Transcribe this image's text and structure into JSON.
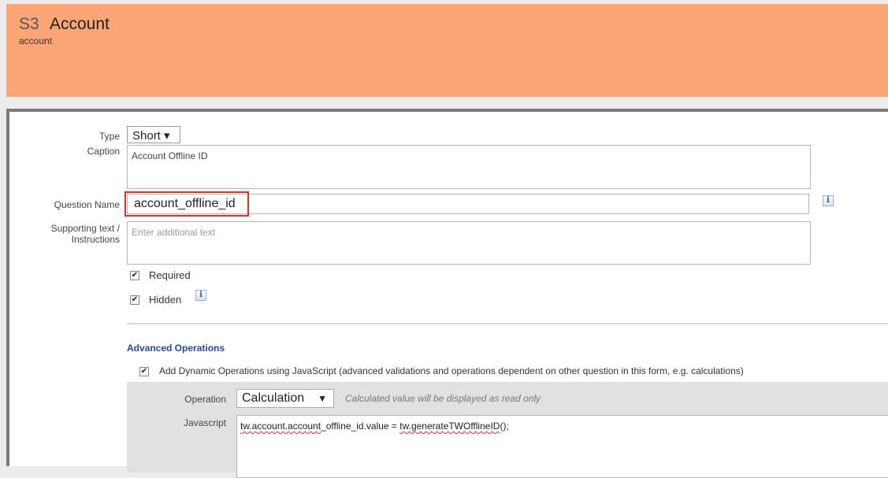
{
  "header": {
    "section_id": "S3",
    "title": "Account",
    "subtitle": "account"
  },
  "form": {
    "type_label": "Type",
    "type_value": "Short ▾",
    "caption_label": "Caption",
    "caption_value": "Account Offline ID",
    "question_name_label": "Question Name",
    "question_name_value": "account_offline_id",
    "supporting_label_line1": "Supporting text /",
    "supporting_label_line2": "Instructions",
    "supporting_placeholder": "Enter additional text",
    "required_label": "Required",
    "hidden_label": "Hidden",
    "info_glyph": "i"
  },
  "advanced": {
    "title": "Advanced Operations",
    "dynamic_label": "Add Dynamic Operations using JavaScript (advanced validations and operations dependent on other question in this form, e.g. calculations)",
    "operation_label": "Operation",
    "operation_value": "Calculation",
    "operation_hint": "Calculated value will be displayed as read only",
    "javascript_label": "Javascript",
    "code_part1": "tw.account.account",
    "code_part2": "_offline_id.value = ",
    "code_part3": "tw.generateTWOfflineID",
    "code_part4": "();"
  },
  "colors": {
    "header_bg": "#fda675",
    "highlight_border": "#d9302a",
    "advanced_title": "#2145b8"
  }
}
